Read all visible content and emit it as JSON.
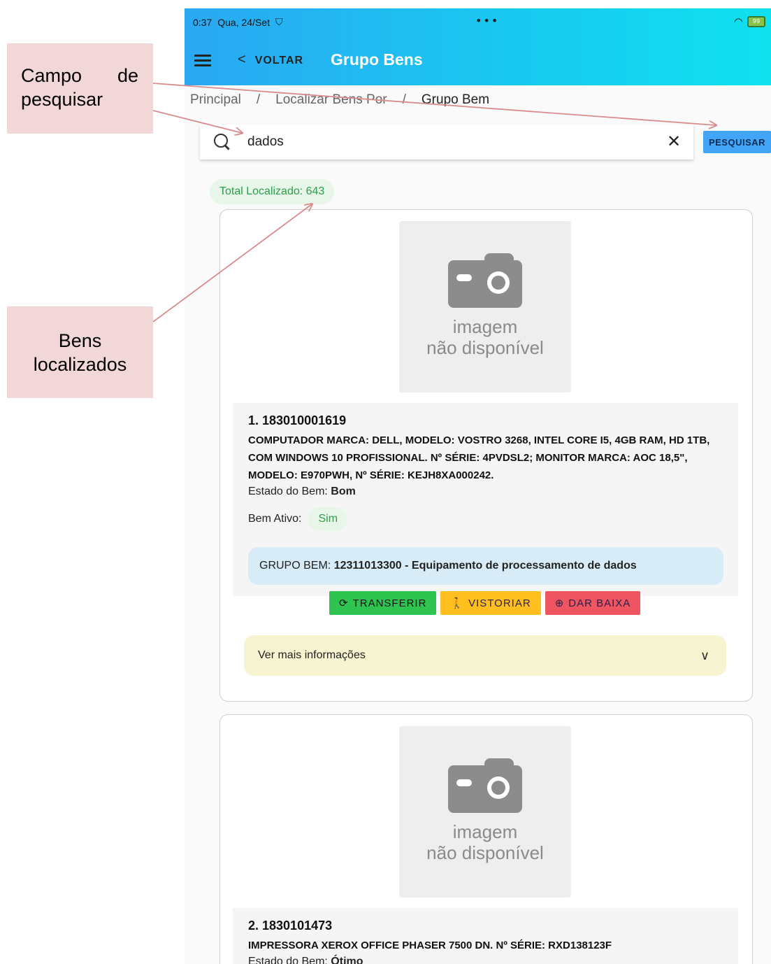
{
  "annotations": {
    "search": {
      "word1": "Campo",
      "word2": "de",
      "line2": "pesquisar"
    },
    "bens": {
      "line1": "Bens",
      "line2": "localizados"
    }
  },
  "status_bar": {
    "time": "0:37",
    "date": "Qua, 24/Set",
    "dots": "•••",
    "battery": "99"
  },
  "app_bar": {
    "back_label": "VOLTAR",
    "title": "Grupo Bens"
  },
  "breadcrumb": [
    "Principal",
    "Localizar Bens Por",
    "Grupo Bem"
  ],
  "search": {
    "value": "dados",
    "button_label": "PESQUISAR"
  },
  "total_label": "Total Localizado: 643",
  "image_placeholder": {
    "line1": "imagem",
    "line2": "não disponível"
  },
  "items": [
    {
      "code": "1. 183010001619",
      "description": "COMPUTADOR MARCA: DELL, MODELO: VOSTRO 3268, INTEL CORE I5, 4GB RAM, HD 1TB, COM WINDOWS 10 PROFISSIONAL. Nº SÉRIE: 4PVDSL2; MONITOR MARCA: AOC 18,5\", MODELO: E970PWH, Nº SÉRIE: KEJH8XA000242.",
      "estado_label": "Estado do Bem:",
      "estado_value": "Bom",
      "ativo_label": "Bem Ativo:",
      "ativo_value": "Sim",
      "grupo_label": "GRUPO BEM:",
      "grupo_value": "12311013300 - Equipamento de processamento de dados",
      "actions": {
        "transferir": "TRANSFERIR",
        "vistoriar": "VISTORIAR",
        "baixa": "DAR BAIXA"
      },
      "more_label": "Ver mais informações"
    },
    {
      "code": "2. 1830101473",
      "description": "IMPRESSORA XEROX OFFICE PHASER 7500 DN. Nº SÉRIE: RXD138123F",
      "estado_label": "Estado do Bem:",
      "estado_value": "Ótimo"
    }
  ],
  "colors": {
    "app_bar_start": "#2aa8f2",
    "app_bar_end": "#0fe1ef",
    "annotation_bg": "#f1d7d8",
    "arrow": "#d98c8c"
  }
}
